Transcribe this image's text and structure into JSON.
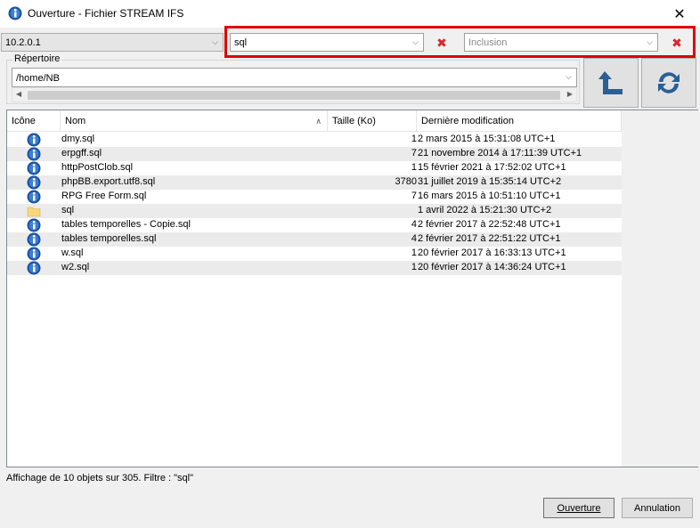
{
  "window": {
    "title": "Ouverture - Fichier STREAM IFS"
  },
  "toolbar": {
    "server": "10.2.0.1",
    "filter_value": "sql",
    "filter_mode_placeholder": "Inclusion"
  },
  "repository": {
    "label": "Répertoire",
    "path": "/home/NB"
  },
  "columns": {
    "icon": "Icône",
    "name": "Nom",
    "size": "Taille (Ko)",
    "modified": "Dernière modification"
  },
  "files": [
    {
      "name": "dmy.sql",
      "size": "1",
      "modified": "2 mars 2015 à 15:31:08 UTC+1",
      "type": "file"
    },
    {
      "name": "erpgff.sql",
      "size": "7",
      "modified": "21 novembre 2014 à 17:11:39 UTC+1",
      "type": "file"
    },
    {
      "name": "httpPostClob.sql",
      "size": "1",
      "modified": "15 février 2021 à 17:52:02 UTC+1",
      "type": "file"
    },
    {
      "name": "phpBB.export.utf8.sql",
      "size": "3780",
      "modified": "31 juillet 2019 à 15:35:14 UTC+2",
      "type": "file"
    },
    {
      "name": "RPG Free Form.sql",
      "size": "7",
      "modified": "16 mars 2015 à 10:51:10 UTC+1",
      "type": "file"
    },
    {
      "name": "sql",
      "size": "",
      "modified": "1 avril 2022 à 15:21:30 UTC+2",
      "type": "folder"
    },
    {
      "name": "tables temporelles - Copie.sql",
      "size": "4",
      "modified": "2 février 2017 à 22:52:48 UTC+1",
      "type": "file"
    },
    {
      "name": "tables temporelles.sql",
      "size": "4",
      "modified": "2 février 2017 à 22:51:22 UTC+1",
      "type": "file"
    },
    {
      "name": "w.sql",
      "size": "1",
      "modified": "20 février 2017 à 16:33:13 UTC+1",
      "type": "file"
    },
    {
      "name": "w2.sql",
      "size": "1",
      "modified": "20 février 2017 à 14:36:24 UTC+1",
      "type": "file"
    }
  ],
  "status": "Affichage de 10 objets sur 305. Filtre : \"sql\"",
  "buttons": {
    "open": "Ouverture",
    "cancel": "Annulation"
  },
  "colors": {
    "accent": "#2a5f95",
    "highlight": "#e00000",
    "clear": "#d8262b"
  }
}
